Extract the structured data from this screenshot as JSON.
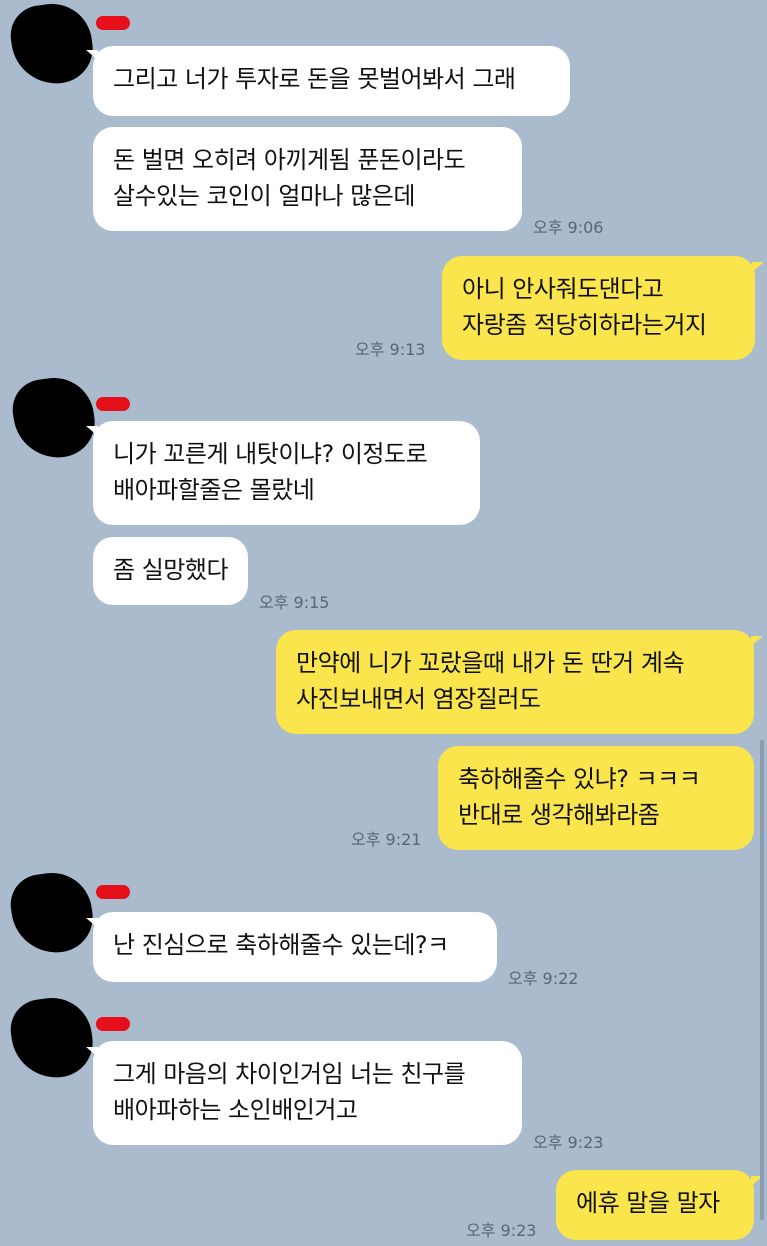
{
  "messages": [
    {
      "side": "in",
      "text": "그리고 너가 투자로 돈을 못벌어봐서 그래"
    },
    {
      "side": "in",
      "text": "돈 벌면 오히려 아끼게됨 푼돈이라도\n살수있는 코인이 얼마나 많은데",
      "time": "오후 9:06"
    },
    {
      "side": "out",
      "text": "아니 안사줘도댄다고\n자랑좀 적당히하라는거지",
      "time": "오후 9:13"
    },
    {
      "side": "in",
      "text": "니가 꼬른게 내탓이냐? 이정도로\n배아파할줄은 몰랐네"
    },
    {
      "side": "in",
      "text": "좀 실망했다",
      "time": "오후 9:15"
    },
    {
      "side": "out",
      "text": "만약에 니가 꼬랐을때 내가 돈 딴거 계속\n사진보내면서 염장질러도"
    },
    {
      "side": "out",
      "text": "축하해줄수 있냐? ㅋㅋㅋ\n반대로 생각해봐라좀",
      "time": "오후 9:21"
    },
    {
      "side": "in",
      "text": "난 진심으로 축하해줄수 있는데?ㅋ",
      "time": "오후 9:22"
    },
    {
      "side": "in",
      "text": "그게 마음의 차이인거임 너는 친구를\n배아파하는 소인배인거고",
      "time": "오후 9:23"
    },
    {
      "side": "out",
      "text": "에휴 말을 말자",
      "time": "오후 9:23"
    }
  ],
  "colors": {
    "background": "#a9bbcd",
    "incoming": "#ffffff",
    "outgoing": "#fae64c"
  }
}
